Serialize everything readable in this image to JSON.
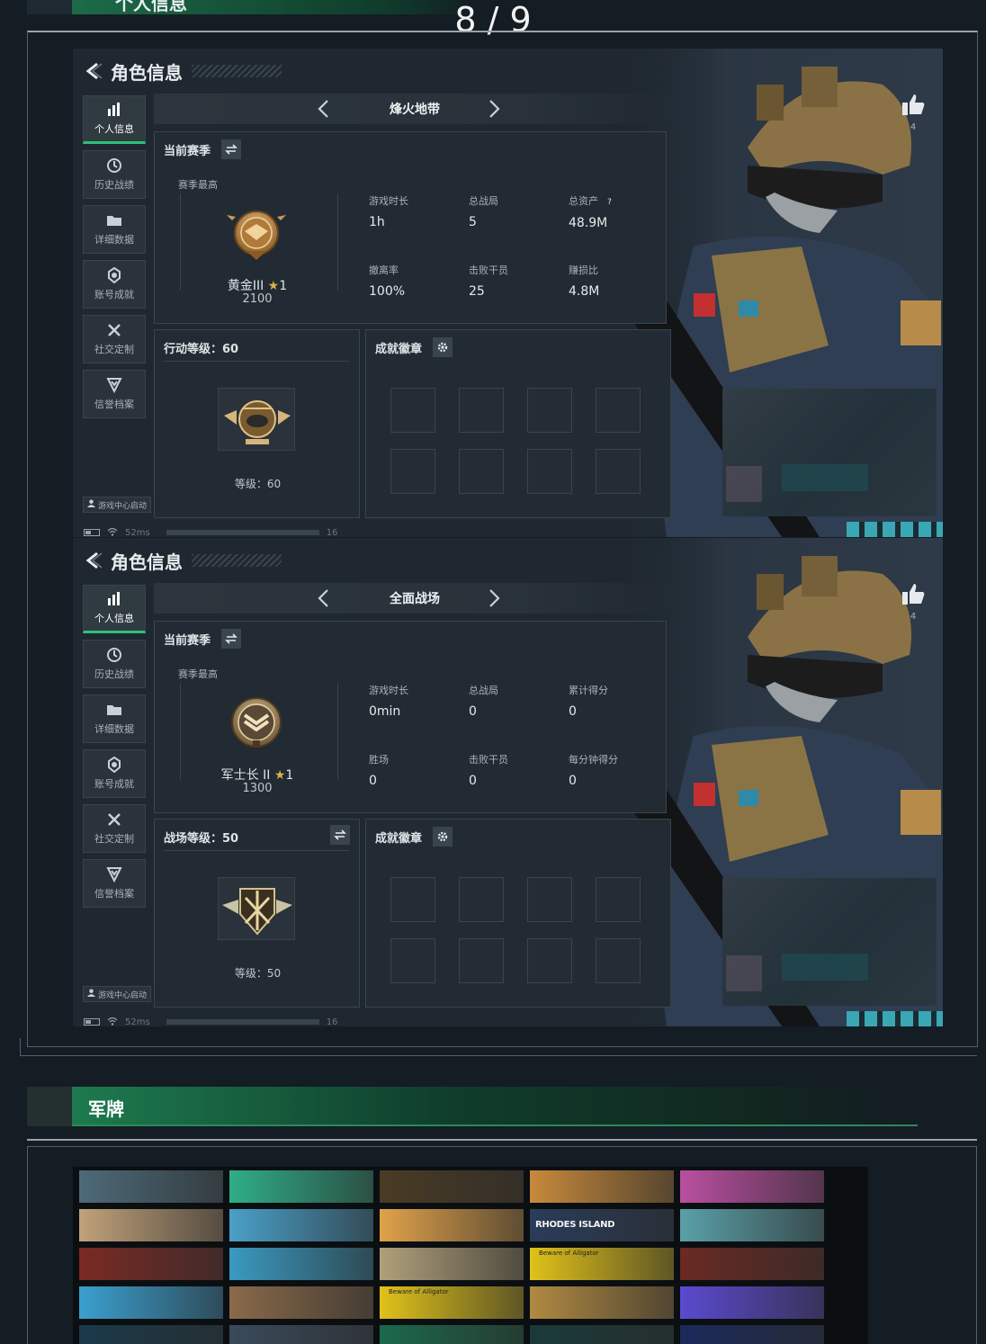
{
  "top": {
    "section_title": "个人信息",
    "page_counter": "8 / 9"
  },
  "panels": [
    {
      "header_title": "角色信息",
      "sidebar": [
        {
          "label": "个人信息",
          "icon": "bar-chart-icon",
          "active": true
        },
        {
          "label": "历史战绩",
          "icon": "history-icon",
          "active": false
        },
        {
          "label": "详细数据",
          "icon": "folder-icon",
          "active": false
        },
        {
          "label": "账号成就",
          "icon": "medal-icon",
          "active": false
        },
        {
          "label": "社交定制",
          "icon": "tools-icon",
          "active": false
        },
        {
          "label": "信誉档案",
          "icon": "shield-icon",
          "active": false
        }
      ],
      "launch_label": "游戏中心启动",
      "ping": "52ms",
      "status_num": "16",
      "mode": "烽火地带",
      "season_label": "当前赛季",
      "season_best": "赛季最高",
      "rank_name": "黄金III",
      "rank_stars": "1",
      "rank_score": "2100",
      "stats": [
        {
          "label": "游戏时长",
          "value": "1h"
        },
        {
          "label": "总战局",
          "value": "5"
        },
        {
          "label": "总资产",
          "value": "48.9M",
          "help": "?"
        },
        {
          "label": "撤离率",
          "value": "100%"
        },
        {
          "label": "击败干员",
          "value": "25"
        },
        {
          "label": "赚损比",
          "value": "4.8M"
        }
      ],
      "level_title": "行动等级：60",
      "level_text": "等级：60",
      "badge_title": "成就徽章",
      "likes": "4"
    },
    {
      "header_title": "角色信息",
      "sidebar": [
        {
          "label": "个人信息",
          "icon": "bar-chart-icon",
          "active": true
        },
        {
          "label": "历史战绩",
          "icon": "history-icon",
          "active": false
        },
        {
          "label": "详细数据",
          "icon": "folder-icon",
          "active": false
        },
        {
          "label": "账号成就",
          "icon": "medal-icon",
          "active": false
        },
        {
          "label": "社交定制",
          "icon": "tools-icon",
          "active": false
        },
        {
          "label": "信誉档案",
          "icon": "shield-icon",
          "active": false
        }
      ],
      "launch_label": "游戏中心启动",
      "ping": "52ms",
      "status_num": "16",
      "mode": "全面战场",
      "season_label": "当前赛季",
      "season_best": "赛季最高",
      "rank_name": "军士长 II",
      "rank_stars": "1",
      "rank_score": "1300",
      "stats": [
        {
          "label": "游戏时长",
          "value": "0min"
        },
        {
          "label": "总战局",
          "value": "0"
        },
        {
          "label": "累计得分",
          "value": "0"
        },
        {
          "label": "胜场",
          "value": "0"
        },
        {
          "label": "击败干员",
          "value": "0"
        },
        {
          "label": "每分钟得分",
          "value": "0"
        }
      ],
      "level_title": "战场等级：50",
      "level_text": "等级：50",
      "badge_title": "成就徽章",
      "likes": "4"
    }
  ],
  "junpai": {
    "section_title": "军牌",
    "cards": [
      {
        "text": "",
        "bg": "#4d6a78"
      },
      {
        "text": "",
        "bg": "#2fae86"
      },
      {
        "text": "",
        "bg": "#4a3b24"
      },
      {
        "text": "",
        "bg": "#c8893c"
      },
      {
        "text": "",
        "bg": "#b94fa1"
      },
      {
        "text": "",
        "bg": "#c0a27a"
      },
      {
        "text": "",
        "bg": "#4aa0c8"
      },
      {
        "text": "",
        "bg": "#e1a24a"
      },
      {
        "text": "RHODES ISLAND",
        "bg": "#2a3c5a"
      },
      {
        "text": "",
        "bg": "#5aa0a8"
      },
      {
        "text": "",
        "bg": "#7a2a24"
      },
      {
        "text": "",
        "bg": "#3a9ac0"
      },
      {
        "text": "",
        "bg": "#b0a07a"
      },
      {
        "text": "Beware of Alligator",
        "bg": "#e0c21a"
      },
      {
        "text": "",
        "bg": "#6a2a22"
      },
      {
        "text": "",
        "bg": "#3aa0d0"
      },
      {
        "text": "",
        "bg": "#8a6a4a"
      },
      {
        "text": "Beware of Alligator",
        "bg": "#e0c21a"
      },
      {
        "text": "",
        "bg": "#b08a42"
      },
      {
        "text": "",
        "bg": "#5a4ad0"
      },
      {
        "text": "",
        "bg": "#1a3a4a"
      },
      {
        "text": "",
        "bg": "#3a4a5a"
      },
      {
        "text": "",
        "bg": "#1a6a4a"
      },
      {
        "text": "",
        "bg": "#1a3a3a"
      },
      {
        "text": "",
        "bg": "#1a2a5a"
      }
    ]
  }
}
